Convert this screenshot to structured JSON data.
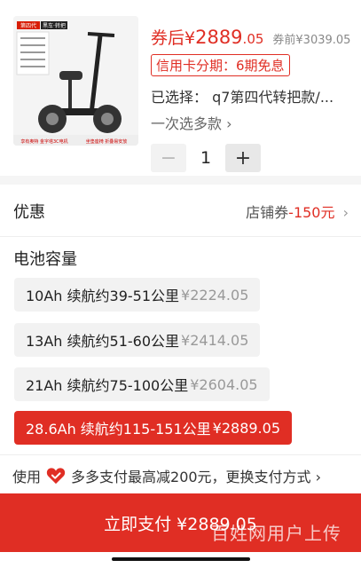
{
  "product": {
    "image_alt": "q7电动滑板车",
    "price_prefix": "券后¥",
    "price_int": "2889",
    "price_dec": ".05",
    "price_before": "券前¥3039.05",
    "installment": "信用卡分期：6期免息",
    "selected": "已选择： q7第四代转把款/...",
    "multi_select": "一次选多款 ›",
    "quantity": "1",
    "minus": "−",
    "plus": "+",
    "image_badges": {
      "top_left": "第四代",
      "top_right": "黑车·转把",
      "bottom_left": "享有奥特 金字塔3C电机",
      "bottom_right": "坐垫座椅 折叠易安放"
    }
  },
  "discount": {
    "label": "优惠",
    "value_prefix": "店铺券",
    "value_amount": "-150元",
    "chevron": "›"
  },
  "battery": {
    "title": "电池容量",
    "options": [
      {
        "label": "10Ah 续航约39-51公里",
        "price": "¥2224.05",
        "selected": false
      },
      {
        "label": "13Ah 续航约51-60公里",
        "price": "¥2414.05",
        "selected": false
      },
      {
        "label": "21Ah 续航约75-100公里",
        "price": "¥2604.05",
        "selected": false
      },
      {
        "label": "28.6Ah 续航约115-151公里",
        "price": "¥2889.05",
        "selected": true
      }
    ]
  },
  "payment": {
    "tip_prefix": "使用",
    "tip_text": "多多支付最高减200元，更换支付方式 ›",
    "button_label": "立即支付 ¥2889.05",
    "watermark": "百姓网用户上传"
  },
  "colors": {
    "accent": "#e02e24"
  }
}
